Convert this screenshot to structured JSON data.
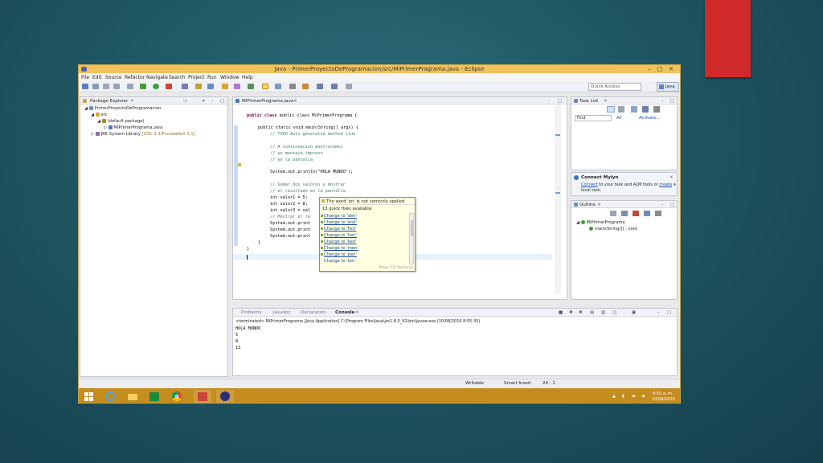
{
  "window": {
    "title": "Java - PrimerProyectoDeProgramacion/src/MiPrimerPrograma.java - Eclipse",
    "controls": [
      "–",
      "□",
      "✕"
    ]
  },
  "menu": [
    "File",
    "Edit",
    "Source",
    "Refactor",
    "Navigate",
    "Search",
    "Project",
    "Run",
    "Window",
    "Help"
  ],
  "toolbar": {
    "quick_access_placeholder": "Quick Access",
    "perspective": "Java"
  },
  "package_explorer": {
    "title": "Package Explorer",
    "tree": [
      "PrimerProyectoDeProgramacion",
      "src",
      "(default package)",
      "MiPrimerPrograma.java",
      "JRE System Library",
      "[CDC-1.1/Foundation-1.1]"
    ]
  },
  "editor": {
    "tab": "MiPrimerPrograma.java",
    "lines": [
      "public class MiPrimerPrograma {",
      "public static void main(String[] args) {",
      "// TODO Auto-generated method stub",
      "// A continuacion mostraremos",
      "// un mensaje impreso",
      "// en la pantalla",
      "System.out.println(\"HOLA MUNDO\");",
      "// Sumar dos valores y mostrar",
      "// el resultado en la pantalla",
      "int valor1 = 5;",
      "int valor2 = 8;",
      "int valor3 = val",
      "// Mostrar el re",
      "System.out.print",
      "System.out.print",
      "System.out.print",
      "}",
      "}"
    ]
  },
  "spell_popup": {
    "header": "The word 'en' is not correctly spelled",
    "count": "13 quick fixes available:",
    "items": [
      "Change to 'den'",
      "Change to 'end'",
      "Change to 'Fen'",
      "Change to 'hen'",
      "Change to 'ken'",
      "Change to 'men'",
      "Change to 'pen'",
      "Change to 'ten'"
    ],
    "footer": "Press 'F2' for focus"
  },
  "task_list": {
    "title": "Task List",
    "find_placeholder": "Find",
    "all": "All",
    "activate": "Activate..."
  },
  "mylyn": {
    "title": "Connect Mylyn",
    "link1": "Connect",
    "text1": "to your task and ALM tools or",
    "link2": "create",
    "text2": "a local task."
  },
  "outline": {
    "title": "Outline",
    "items": [
      "MiPrimerPrograma",
      "main(String[]) : void"
    ]
  },
  "bottom_tabs": [
    "Problems",
    "Javadoc",
    "Declaration",
    "Console"
  ],
  "console": {
    "status": "<terminated> MiPrimerPrograma [Java Application] C:\\Program Files\\Java\\jre1.8.0_91\\bin\\javaw.exe (10/08/2016 8:55:35)",
    "output": [
      "HOLA MUNDO",
      "5",
      "8",
      "13"
    ]
  },
  "statusbar": {
    "writable": "Writable",
    "insert": "Smart Insert",
    "position": "24 : 1"
  },
  "taskbar": {
    "time": "8:55 a. m.",
    "date": "10/08/2016"
  }
}
